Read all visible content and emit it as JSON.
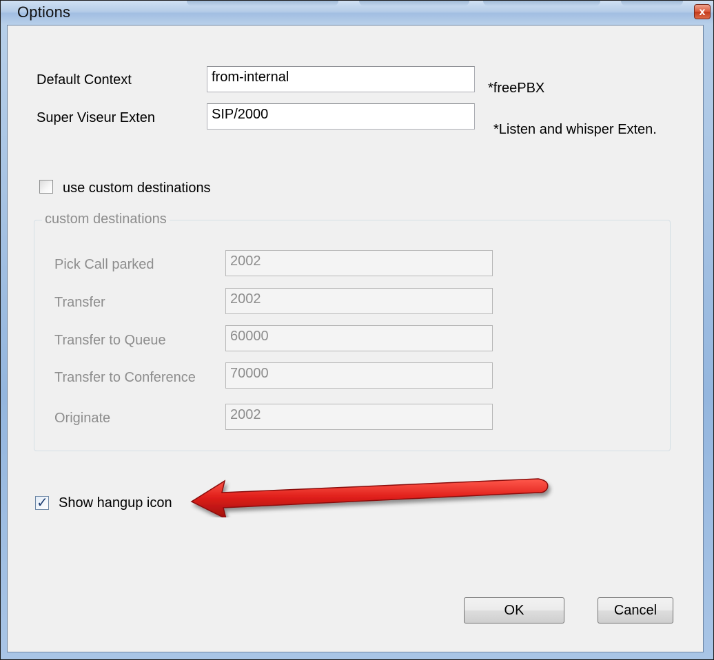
{
  "window": {
    "title": "Options",
    "close_label": "x"
  },
  "general": {
    "default_context_label": "Default Context",
    "default_context_value": "from-internal",
    "default_context_note": "*freePBX",
    "supervisor_exten_label": "Super Viseur Exten",
    "supervisor_exten_value": "SIP/2000",
    "supervisor_exten_note": "*Listen and whisper Exten."
  },
  "custom_destinations": {
    "checkbox_label": "use custom destinations",
    "checked": false,
    "group_title": "custom destinations",
    "fields": [
      {
        "label": "Pick Call parked",
        "value": "2002"
      },
      {
        "label": "Transfer",
        "value": "2002"
      },
      {
        "label": "Transfer to Queue",
        "value": "60000"
      },
      {
        "label": "Transfer to Conference",
        "value": "70000"
      },
      {
        "label": "Originate",
        "value": "2002"
      }
    ]
  },
  "hangup": {
    "checkbox_label": "Show hangup icon",
    "checked": true
  },
  "buttons": {
    "ok_label": "OK",
    "cancel_label": "Cancel"
  },
  "colors": {
    "arrow": "#e0201b",
    "disabled_text": "#8d8d8d"
  }
}
